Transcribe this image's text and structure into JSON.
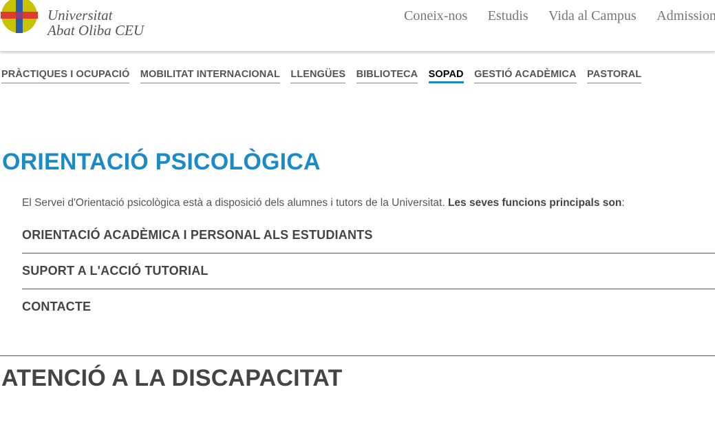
{
  "header": {
    "brand_line1": "Universitat",
    "brand_line2": "Abat Oliba CEU",
    "nav": [
      "Coneix-nos",
      "Estudis",
      "Vida al Campus",
      "Admissions"
    ]
  },
  "subnav": {
    "items": [
      "PRÀCTIQUES I OCUPACIÓ",
      "MOBILITAT INTERNACIONAL",
      "LLENGÜES",
      "BIBLIOTECA",
      "SOPAD",
      "GESTIÓ ACADÈMICA",
      "PASTORAL"
    ],
    "active": "SOPAD"
  },
  "main": {
    "title": "ORIENTACIÓ PSICOLÒGICA",
    "intro_text": "El Servei d'Orientació psicològica està a disposició dels alumnes i tutors de la Universitat. ",
    "intro_bold": "Les seves funcions principals son",
    "intro_end": ":",
    "accordion": [
      "ORIENTACIÓ ACADÈMICA I PERSONAL ALS ESTUDIANTS",
      "SUPORT A L'ACCIÓ TUTORIAL",
      "CONTACTE"
    ],
    "section2_title": "ATENCIÓ A LA DISCAPACITAT"
  },
  "colors": {
    "accent": "#1a8bc6",
    "logo_yellow": "#c8c200",
    "logo_red": "#e03a2e",
    "logo_blue": "#2d5ba8"
  }
}
